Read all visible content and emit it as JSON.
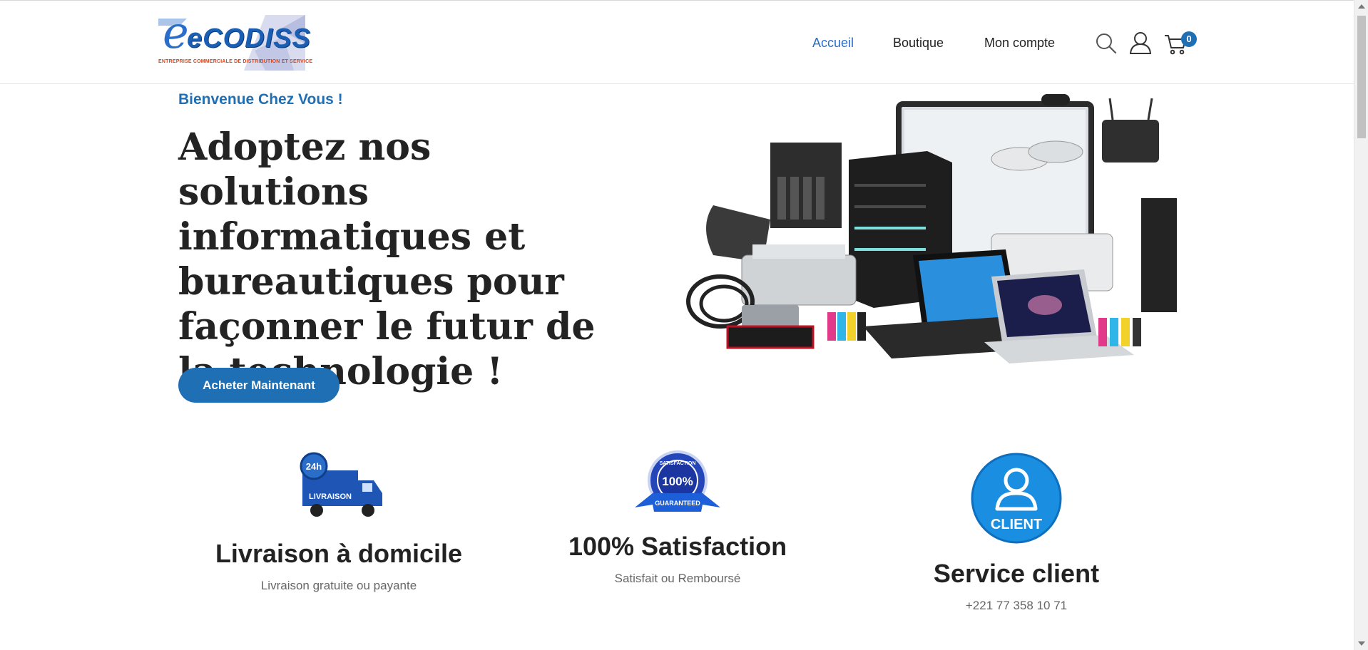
{
  "header": {
    "logo": {
      "brand": "eCODISS",
      "tagline": "ENTREPRISE COMMERCIALE DE DISTRIBUTION ET SERVICE"
    },
    "nav": [
      {
        "label": "Accueil",
        "active": true
      },
      {
        "label": "Boutique",
        "active": false
      },
      {
        "label": "Mon compte",
        "active": false
      }
    ],
    "icons": [
      "search-icon",
      "user-icon",
      "cart-icon"
    ],
    "cart_count": "0"
  },
  "hero": {
    "welcome": "Bienvenue Chez Vous !",
    "headline": "Adoptez nos solutions informatiques et bureautiques pour façonner le futur de la technologie !",
    "cta_label": "Acheter Maintenant"
  },
  "features": [
    {
      "title": "Livraison à domicile",
      "subtitle": "Livraison gratuite ou payante",
      "badge": "LIVRAISON",
      "badge_top": "24h",
      "icon": "delivery-truck-icon"
    },
    {
      "title": "100% Satisfaction",
      "subtitle": "Satisfait ou Remboursé",
      "badge": "GUARANTEED",
      "badge_top": "SATISFACTION",
      "badge_mid": "100%",
      "icon": "satisfaction-seal-icon"
    },
    {
      "title": "Service client",
      "subtitle": "+221 77 358 10 71",
      "badge": "CLIENT",
      "icon": "client-icon"
    }
  ],
  "colors": {
    "accent": "#1f6fb5",
    "text": "#232323",
    "muted": "#666666"
  }
}
